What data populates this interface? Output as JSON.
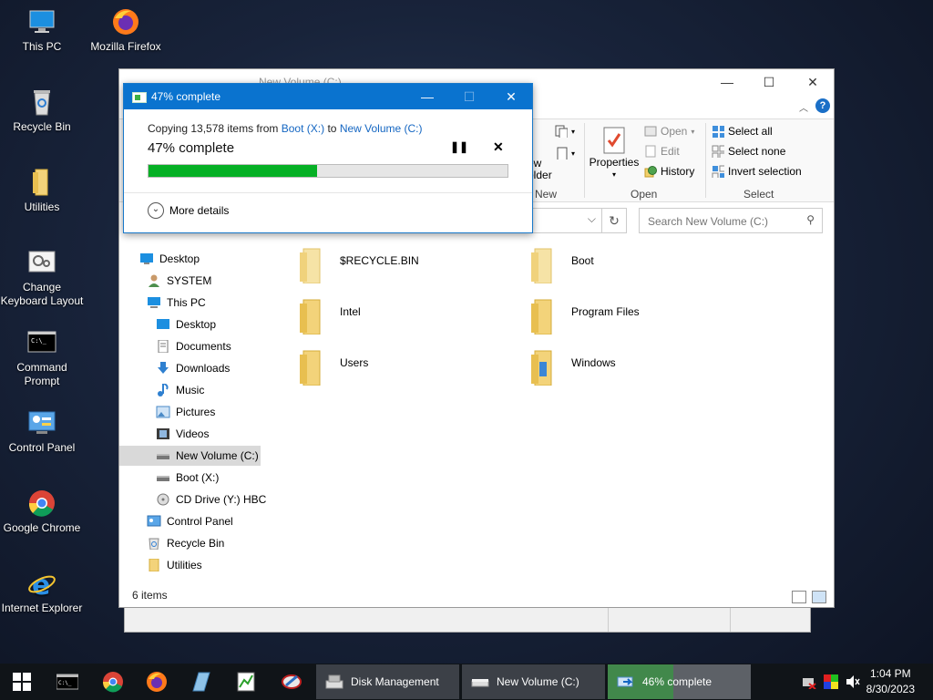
{
  "desktop": {
    "icons": [
      {
        "label": "This PC"
      },
      {
        "label": "Mozilla Firefox"
      },
      {
        "label": "Recycle Bin"
      },
      {
        "label": "Utilities"
      },
      {
        "label": "Change Keyboard Layout"
      },
      {
        "label": "Command Prompt"
      },
      {
        "label": "Control Panel"
      },
      {
        "label": "Google Chrome"
      },
      {
        "label": "Internet Explorer"
      }
    ]
  },
  "explorer": {
    "title": "New Volume (C:)",
    "ribbon": {
      "new_partial": "ew\nolder",
      "new_group": "New",
      "properties": "Properties",
      "open": "Open",
      "edit": "Edit",
      "history": "History",
      "open_group": "Open",
      "select_all": "Select all",
      "select_none": "Select none",
      "invert_selection": "Invert selection",
      "select_group": "Select"
    },
    "search_placeholder": "Search New Volume (C:)",
    "nav": [
      {
        "label": "Desktop"
      },
      {
        "label": "SYSTEM"
      },
      {
        "label": "This PC"
      },
      {
        "label": "Desktop"
      },
      {
        "label": "Documents"
      },
      {
        "label": "Downloads"
      },
      {
        "label": "Music"
      },
      {
        "label": "Pictures"
      },
      {
        "label": "Videos"
      },
      {
        "label": "New Volume (C:)"
      },
      {
        "label": "Boot (X:)"
      },
      {
        "label": "CD Drive (Y:) HBC"
      },
      {
        "label": "Control Panel"
      },
      {
        "label": "Recycle Bin"
      },
      {
        "label": "Utilities"
      }
    ],
    "folders": [
      {
        "label": "$RECYCLE.BIN"
      },
      {
        "label": "Boot"
      },
      {
        "label": "Intel"
      },
      {
        "label": "Program Files"
      },
      {
        "label": "Users"
      },
      {
        "label": "Windows"
      }
    ],
    "status": "6 items"
  },
  "dialog": {
    "title": "47% complete",
    "copy_prefix": "Copying 13,578 items from",
    "source": "Boot (X:)",
    "to": "to",
    "dest": "New Volume (C:)",
    "percent_label": "47% complete",
    "progress": 0.47,
    "more_details": "More details"
  },
  "taskbar": {
    "tasks": [
      {
        "label": "Disk Management"
      },
      {
        "label": "New Volume (C:)"
      },
      {
        "label": "46% complete",
        "progress": 0.46
      }
    ],
    "time": "1:04 PM",
    "date": "8/30/2023"
  },
  "colors": {
    "accent": "#0a73cf",
    "progress": "#06b025",
    "link": "#1466c2"
  }
}
